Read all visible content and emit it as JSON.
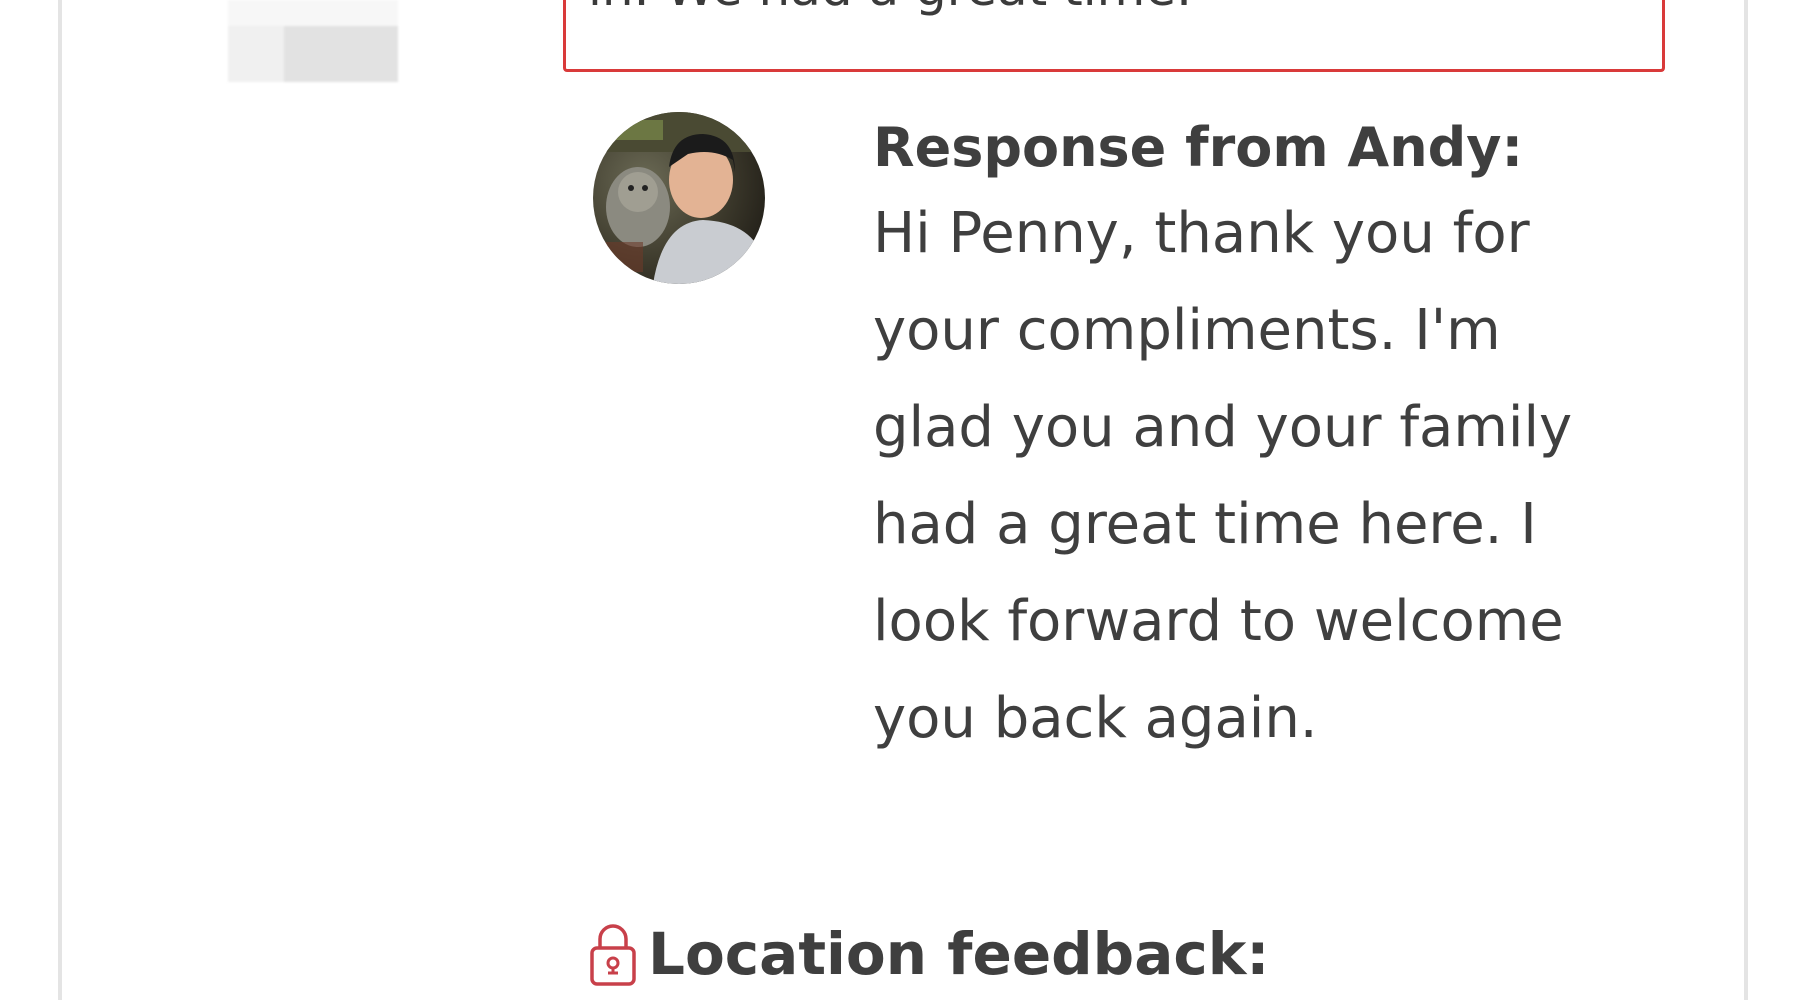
{
  "review": {
    "partial_text": "in. We had a great time."
  },
  "host_response": {
    "avatar_icon": "host-avatar-photo",
    "title": "Response from Andy:",
    "lines": [
      "Hi Penny, thank you for",
      "your compliments. I'm",
      "glad you and your family",
      "had a great time here. I",
      "look forward to welcome",
      "you back again."
    ]
  },
  "location_feedback": {
    "icon": "lock-icon",
    "title": "Location feedback:"
  },
  "colors": {
    "highlight_border": "#d93a3a",
    "text": "#3f3f3f",
    "lock_icon": "#c8404a",
    "frame_border": "#e4e4e4"
  }
}
